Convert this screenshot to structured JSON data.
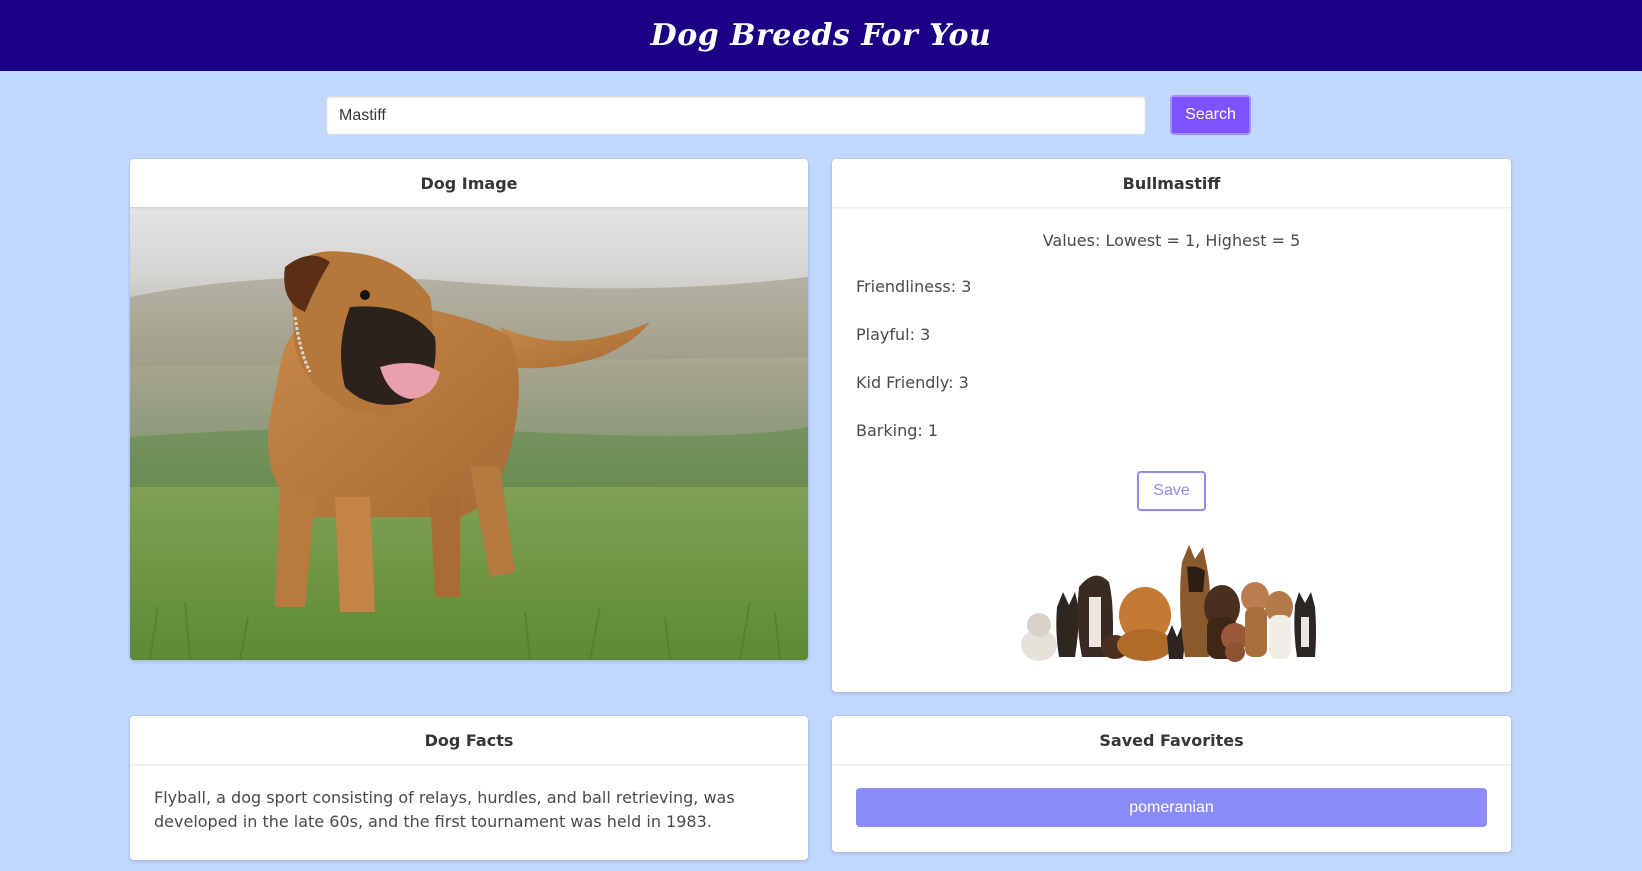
{
  "header": {
    "title": "Dog Breeds For You"
  },
  "search": {
    "value": "Mastiff",
    "button_label": "Search"
  },
  "image_card": {
    "title": "Dog Image"
  },
  "breed_card": {
    "title": "Bullmastiff",
    "values_note": "Values: Lowest = 1, Highest = 5",
    "stats": {
      "friendliness": "Friendliness: 3",
      "playful": "Playful: 3",
      "kid_friendly": "Kid Friendly: 3",
      "barking": "Barking: 1"
    },
    "save_label": "Save"
  },
  "facts_card": {
    "title": "Dog Facts",
    "fact": "Flyball, a dog sport consisting of relays, hurdles, and ball retrieving, was developed in the late 60s, and the first tournament was held in 1983."
  },
  "saved_card": {
    "title": "Saved Favorites",
    "items": [
      "pomeranian"
    ]
  },
  "colors": {
    "header_bg": "#1a0085",
    "page_bg": "#c1d7fd",
    "search_button": "#7d53ff",
    "favorite_button": "#8b8bf9",
    "save_outline": "#8b8bf5"
  }
}
